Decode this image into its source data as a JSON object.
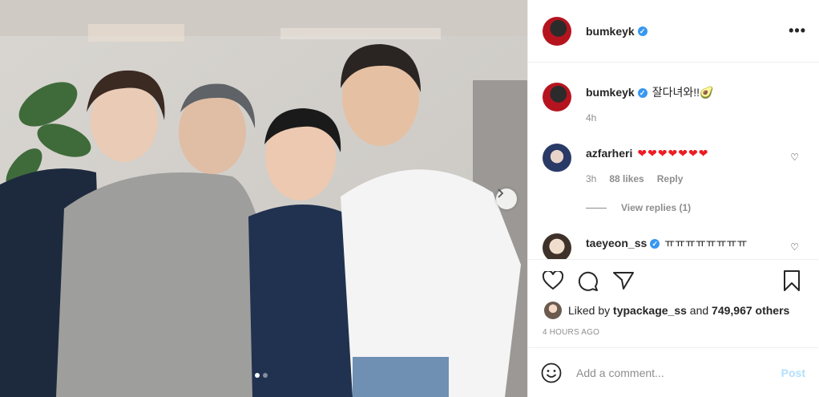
{
  "post": {
    "author": "bumkeyk",
    "verified": true,
    "caption": "잘다녀와!!🥑",
    "caption_age": "4h",
    "more_label": "•••"
  },
  "carousel": {
    "current": 1,
    "total": 2,
    "next_label": "›"
  },
  "comments": [
    {
      "user": "azfarheri",
      "text": "❤❤❤❤❤❤❤",
      "age": "3h",
      "likes": "88 likes",
      "reply_label": "Reply",
      "view_replies": "View replies (1)"
    },
    {
      "user": "taeyeon_ss",
      "verified": true,
      "text": "ㅠㅠㅠㅠㅠㅠㅠㅠ"
    }
  ],
  "likes": {
    "prefix": "Liked by",
    "user": "typackage_ss",
    "middle": "and",
    "count": "749,967 others"
  },
  "timestamp": "4 HOURS AGO",
  "add_comment": {
    "placeholder": "Add a comment...",
    "post_label": "Post"
  },
  "colors": {
    "accent": "#3897f0",
    "post_disabled": "#b2dffc",
    "muted": "#8e8e8e",
    "heart": "#ed1c24"
  }
}
